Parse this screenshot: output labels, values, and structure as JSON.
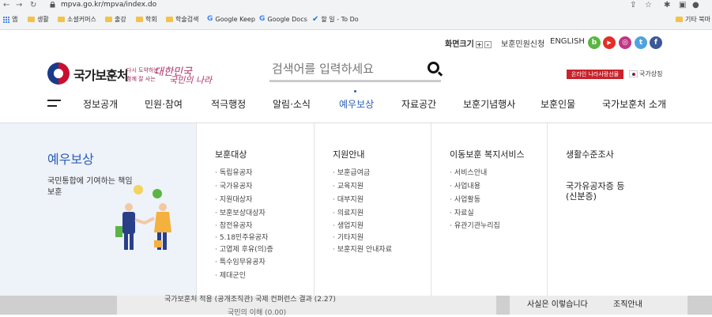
{
  "browser": {
    "url": "mpva.go.kr/mpva/index.do",
    "bookmarks": [
      {
        "label": "앱",
        "type": "apps"
      },
      {
        "label": "생활",
        "type": "folder"
      },
      {
        "label": "소셜커머스",
        "type": "folder"
      },
      {
        "label": "출강",
        "type": "folder"
      },
      {
        "label": "학회",
        "type": "folder"
      },
      {
        "label": "학술검색",
        "type": "folder"
      },
      {
        "label": "Google Keep",
        "type": "google"
      },
      {
        "label": "Google Docs",
        "type": "google"
      },
      {
        "label": "할 일 - To Do",
        "type": "check"
      },
      {
        "label": "기타 북마",
        "type": "folder"
      }
    ]
  },
  "util": {
    "zoom_label": "화면크기",
    "zoom_plus": "+",
    "zoom_minus": "-",
    "civil_link": "보훈민원신청",
    "english_link": "ENGLISH",
    "sns": [
      {
        "name": "blog",
        "glyph": "b",
        "color": "#5bb544"
      },
      {
        "name": "youtube",
        "glyph": "▶",
        "color": "#e52d27"
      },
      {
        "name": "instagram",
        "glyph": "◎",
        "color": "#c13584"
      },
      {
        "name": "twitter",
        "glyph": "t",
        "color": "#4fa3e0"
      },
      {
        "name": "facebook",
        "glyph": "f",
        "color": "#3b5998"
      }
    ]
  },
  "header": {
    "logo_text": "국가보훈처",
    "slogan_small1": "다시 도약하는",
    "slogan_small2": "함께 잘 사는",
    "slogan_big1": "대한민국",
    "slogan_big2": "국민의 나라",
    "search_placeholder": "검색어를 입력하세요",
    "online_button": "온라인 나라사랑선물",
    "symbol_label": "국가상징"
  },
  "gnb": [
    {
      "label": "정보공개",
      "active": false
    },
    {
      "label": "민원·참여",
      "active": false
    },
    {
      "label": "적극행정",
      "active": false
    },
    {
      "label": "알림·소식",
      "active": false
    },
    {
      "label": "예우보상",
      "active": true
    },
    {
      "label": "자료공간",
      "active": false
    },
    {
      "label": "보훈기념행사",
      "active": false
    },
    {
      "label": "보훈인물",
      "active": false
    },
    {
      "label": "국가보훈처 소개",
      "active": false
    }
  ],
  "mega": {
    "title": "예우보상",
    "subtitle": "국민통합에 기여하는 책임보훈",
    "columns": [
      {
        "title": "보훈대상",
        "items": [
          "독립유공자",
          "국가유공자",
          "지원대상자",
          "보훈보상대상자",
          "참전유공자",
          "5.18민주유공자",
          "고엽제 후유(의)증",
          "특수임무유공자",
          "제대군인"
        ]
      },
      {
        "title": "지원안내",
        "items": [
          "보훈급여금",
          "교육지원",
          "대부지원",
          "의료지원",
          "생업지원",
          "기타지원",
          "보훈지원 안내자료"
        ]
      },
      {
        "title": "이동보훈 복지서비스",
        "items": [
          "서비스안내",
          "사업내용",
          "사업활동",
          "자료실",
          "유관기관누리집"
        ]
      },
      {
        "title": "생활수준조사",
        "title2": "국가유공자증 등 (신분증)",
        "items": []
      }
    ]
  },
  "below": {
    "left_peek": "국가보훈처 적용 (공개조직관) 국제 컨퍼런스 결과 (2.27)",
    "left_peek2": "국민의 이해 (0.00)",
    "right_peek1": "사실은 이렇습니다",
    "right_peek2": "조직안내"
  }
}
